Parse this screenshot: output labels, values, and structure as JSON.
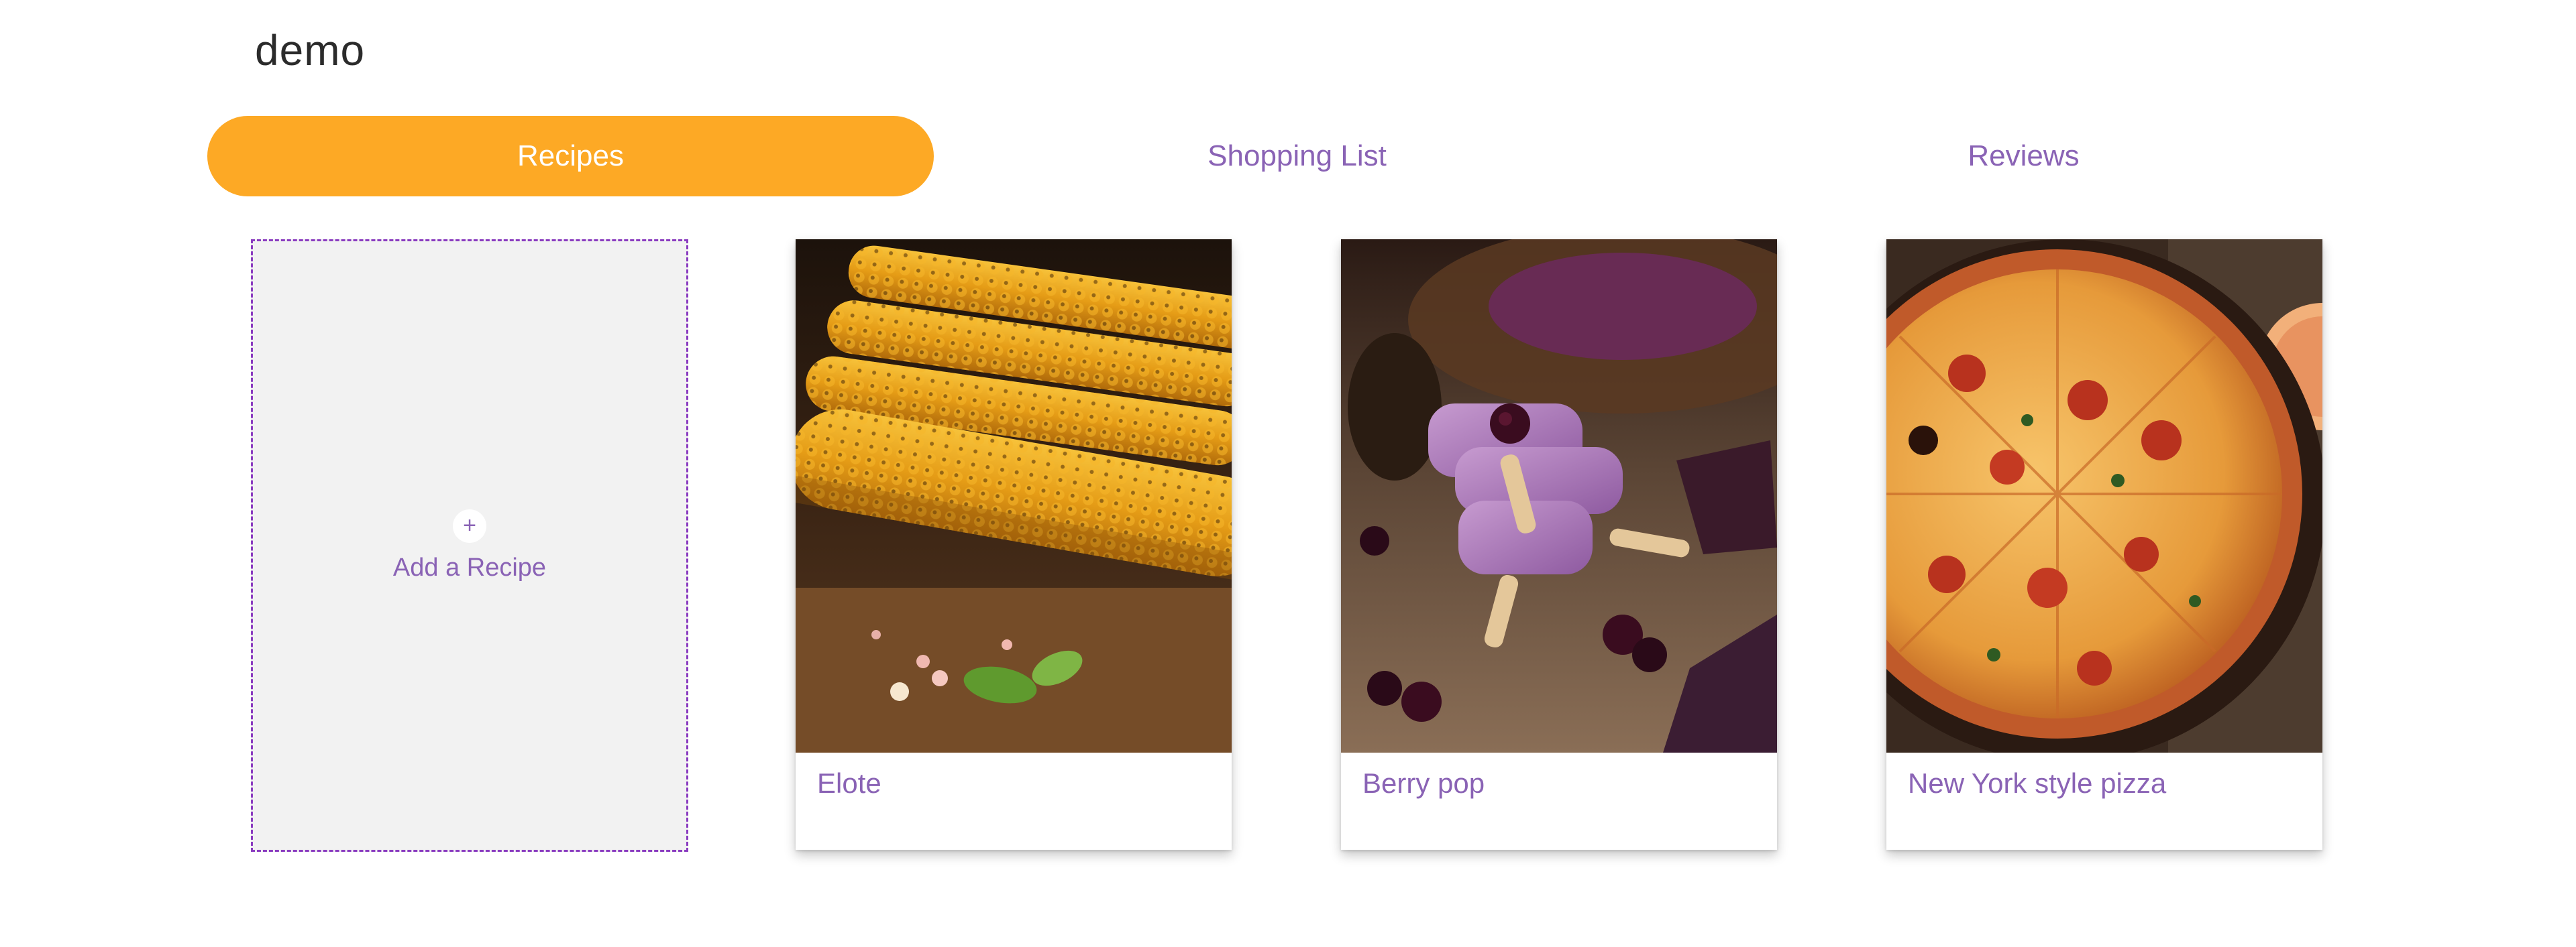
{
  "app": {
    "title": "demo"
  },
  "tabs": [
    {
      "label": "Recipes",
      "active": true
    },
    {
      "label": "Shopping List",
      "active": false
    },
    {
      "label": "Reviews",
      "active": false
    }
  ],
  "add_card": {
    "icon": "plus-icon",
    "icon_glyph": "+",
    "label": "Add a Recipe"
  },
  "recipes": [
    {
      "name": "Elote",
      "image": "grilled-corn-photo"
    },
    {
      "name": "Berry pop",
      "image": "berry-popsicle-photo"
    },
    {
      "name": "New York style pizza",
      "image": "pizza-photo"
    }
  ],
  "colors": {
    "accent": "#fda925",
    "link": "#8a63b5",
    "dashed_border": "#8a3bc0",
    "placeholder_bg": "#f2f2f2"
  }
}
